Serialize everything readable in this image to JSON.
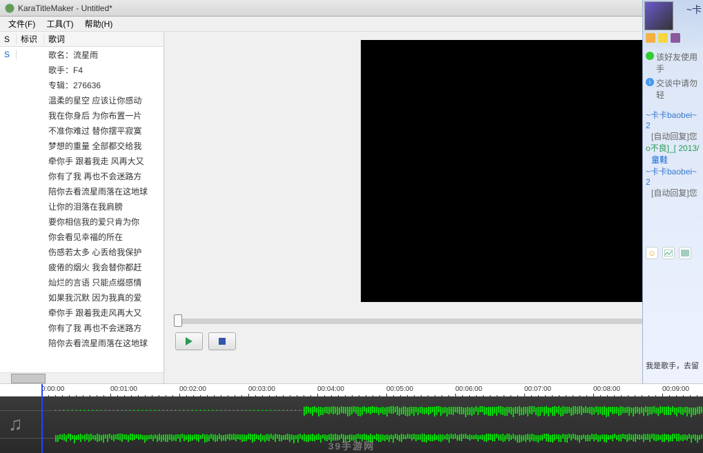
{
  "window": {
    "title": "KaraTitleMaker - Untitled*"
  },
  "menu": {
    "file": "文件(F)",
    "tools": "工具(T)",
    "help": "帮助(H)"
  },
  "columns": {
    "s": "S",
    "mark": "标识",
    "lyric": "歌词"
  },
  "lyrics": [
    {
      "s": "S",
      "text": "歌名：流星雨"
    },
    {
      "s": "",
      "text": "歌手：F4"
    },
    {
      "s": "",
      "text": "专辑：276636"
    },
    {
      "s": "",
      "text": "温柔的星空 应该让你感动"
    },
    {
      "s": "",
      "text": "我在你身后 为你布置一片"
    },
    {
      "s": "",
      "text": "不准你难过 替你摆平寂寞"
    },
    {
      "s": "",
      "text": "梦想的重量 全部都交给我"
    },
    {
      "s": "",
      "text": "牵你手 跟着我走 风再大又"
    },
    {
      "s": "",
      "text": "你有了我 再也不会迷路方"
    },
    {
      "s": "",
      "text": "陪你去看流星雨落在这地球"
    },
    {
      "s": "",
      "text": "让你的泪落在我肩膀"
    },
    {
      "s": "",
      "text": "要你相信我的爱只肯为你"
    },
    {
      "s": "",
      "text": "你会看见幸福的所在"
    },
    {
      "s": "",
      "text": "伤感若太多 心丢给我保护"
    },
    {
      "s": "",
      "text": "疲倦的烟火 我会替你都赶"
    },
    {
      "s": "",
      "text": "灿烂的言语 只能点缀感情"
    },
    {
      "s": "",
      "text": "如果我沉默 因为我真的爱"
    },
    {
      "s": "",
      "text": "牵你手 跟着我走风再大又"
    },
    {
      "s": "",
      "text": "你有了我 再也不会迷路方"
    },
    {
      "s": "",
      "text": "陪你去看流星雨落在这地球"
    }
  ],
  "timeline": {
    "labels": [
      "0:00:00",
      "00:01:00",
      "00:02:00",
      "00:03:00",
      "00:04:00",
      "00:05:00",
      "00:06:00",
      "00:07:00",
      "00:08:00",
      "00:09:00"
    ]
  },
  "watermark": "39手游网",
  "chat": {
    "title": "~卡",
    "notice1": "该好友使用手",
    "notice2": "交谈中请勿轻",
    "msg1_name": "~卡卡baobei~ 2",
    "msg1_auto": "[自动回复]您",
    "msg2_name": "o不良]_[ 2013/",
    "msg2_link": "童鞋",
    "msg3_name": "~卡卡baobei~ 2",
    "msg3_auto": "[自动回复]您",
    "footer": "我是歌手，去留"
  }
}
